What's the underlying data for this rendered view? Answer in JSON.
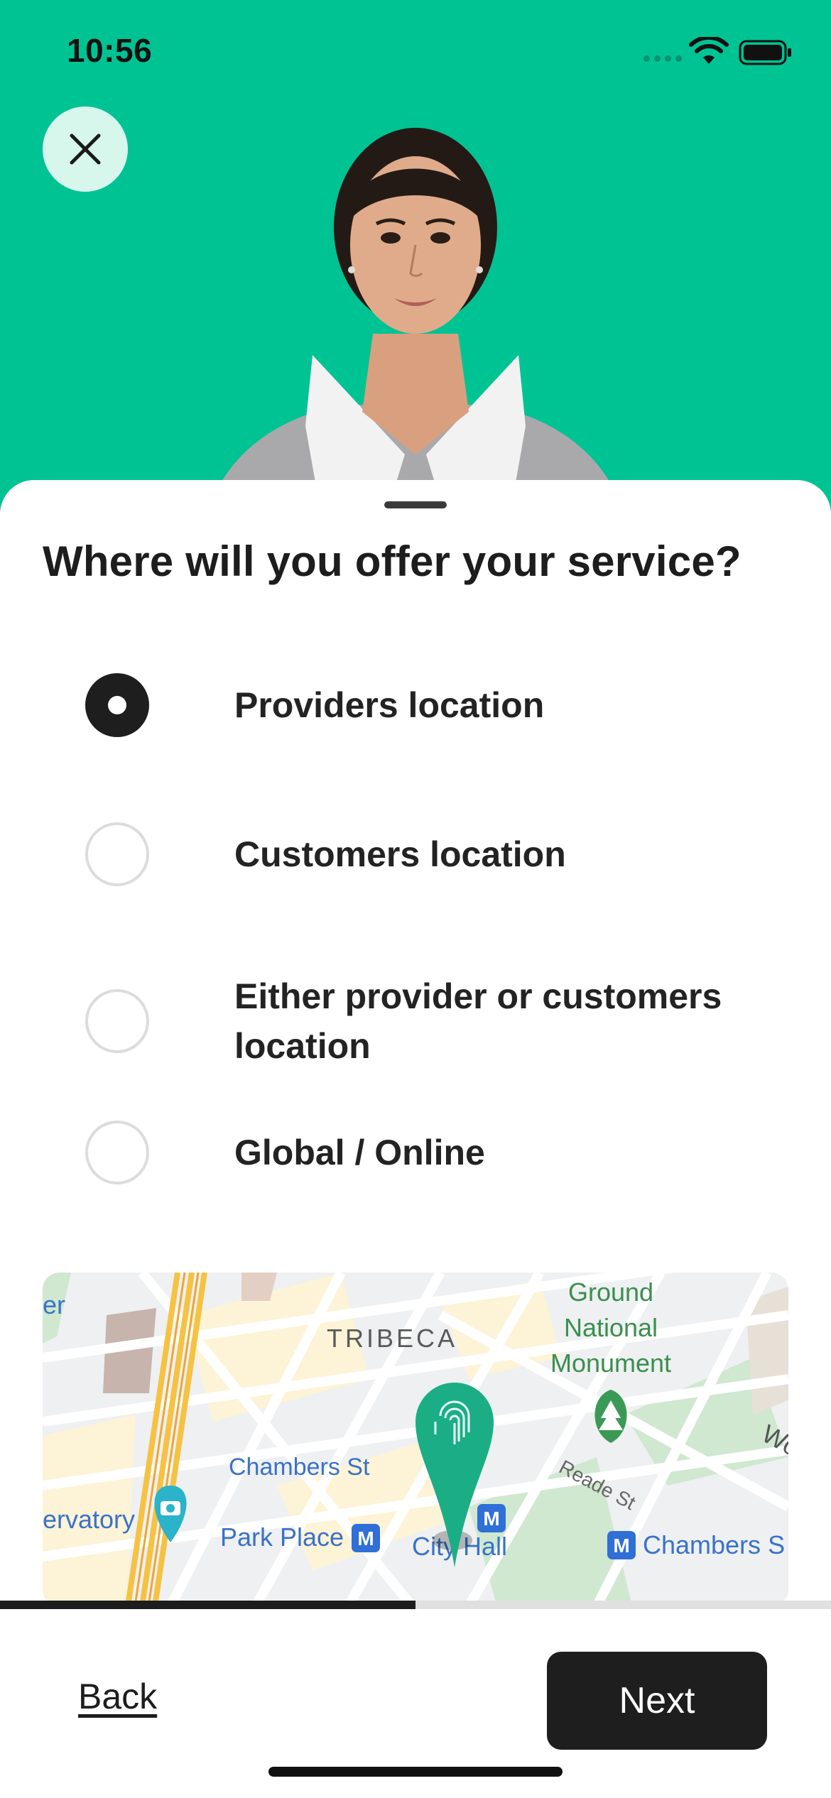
{
  "status_bar": {
    "time": "10:56"
  },
  "header": {
    "background_color": "#00c394",
    "close_icon": "close-icon",
    "image": "provider-portrait"
  },
  "sheet": {
    "question": "Where will you offer your service?",
    "options": [
      {
        "label": "Providers location",
        "selected": true
      },
      {
        "label": "Customers location",
        "selected": false
      },
      {
        "label": "Either provider or customers location",
        "selected": false
      },
      {
        "label": "Global / Online",
        "selected": false
      }
    ]
  },
  "map": {
    "labels": {
      "tribeca": "TRIBECA",
      "monument": [
        "Ground",
        "National",
        "Monument"
      ],
      "chambers_st_left": "Chambers St",
      "chambers_st_right": "Chambers S",
      "park_place": "Park Place",
      "city_hall": "City Hall",
      "reade_st": "Reade St",
      "observatory": "ervatory",
      "edge_left": "er",
      "edge_right": "Wo",
      "metro_symbol": "M"
    },
    "pin_icon": "fingerprint-pin-icon"
  },
  "progress": {
    "value": 0.5
  },
  "footer": {
    "back_label": "Back",
    "next_label": "Next"
  }
}
